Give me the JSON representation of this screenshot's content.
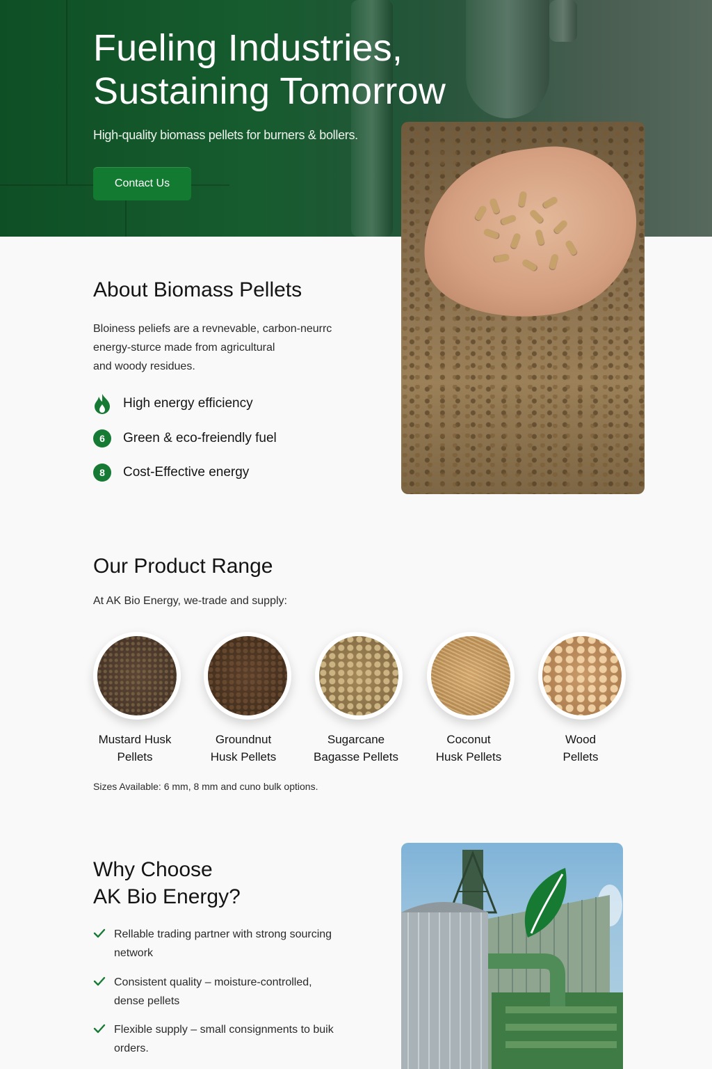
{
  "hero": {
    "title_line1": "Fueling Industries,",
    "title_line2": "Sustaining Tomorrow",
    "subtitle": "High-quality biomass pellets for burners & bollers.",
    "cta_label": "Contact Us"
  },
  "about": {
    "title": "About Biomass Pellets",
    "body_line1": "Bloiness peliefs are a revnevable, carbon-neurrc",
    "body_line2": "energy-sturce made from agricultural",
    "body_line3": "and woody residues.",
    "features": [
      {
        "icon": "flame-leaf-icon",
        "badge": "",
        "label": "High energy efficiency"
      },
      {
        "icon": "number-badge",
        "badge": "6",
        "label": "Green & eco-freiendly fuel"
      },
      {
        "icon": "number-badge",
        "badge": "8",
        "label": "Cost-Effective energy"
      }
    ]
  },
  "products": {
    "title": "Our Product Range",
    "intro": "At AK Bio Energy, we-trade and supply:",
    "items": [
      {
        "line1": "Mustard Husk",
        "line2": "Pellets"
      },
      {
        "line1": "Groundnut",
        "line2": "Husk Pellets"
      },
      {
        "line1": "Sugarcane",
        "line2": "Bagasse Pellets"
      },
      {
        "line1": "Coconut",
        "line2": "Husk Pellets"
      },
      {
        "line1": "Wood",
        "line2": "Pellets"
      }
    ],
    "sizes_note": "Sizes Available: 6 mm, 8 mm and cuno bulk options."
  },
  "why": {
    "title_line1": "Why Choose",
    "title_line2": "AK Bio Energy?",
    "items": [
      {
        "line1": "Rellable trading partner with strong sourcing",
        "line2": "network"
      },
      {
        "line1": "Consistent quality – moisture-controlled,",
        "line2": "dense pellets"
      },
      {
        "line1": "Flexible supply – small consignments to buik",
        "line2": "orders."
      }
    ]
  },
  "colors": {
    "brand_green": "#137a32",
    "hero_green": "#0f4f25",
    "text_dark": "#141414"
  }
}
